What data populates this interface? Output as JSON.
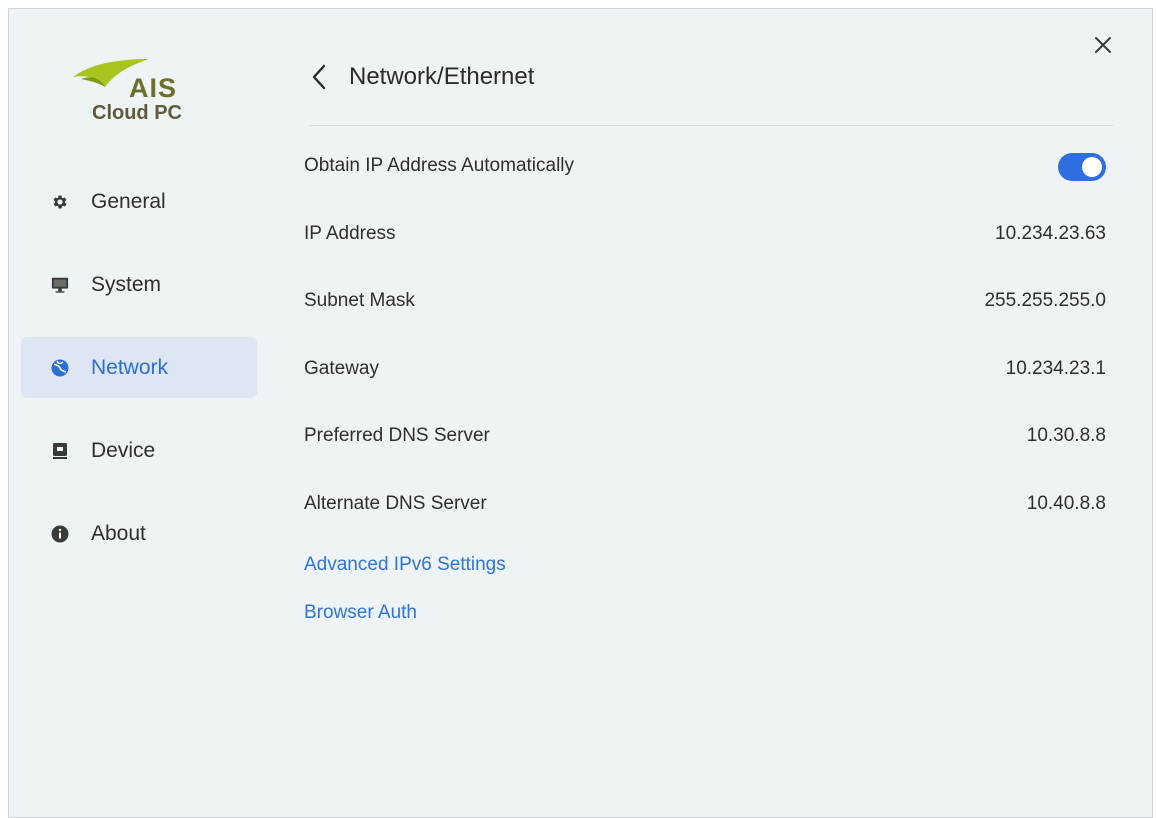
{
  "brand": {
    "name": "AIS",
    "product": "Cloud PC"
  },
  "sidebar": {
    "items": [
      {
        "label": "General",
        "icon": "gear-icon",
        "active": false
      },
      {
        "label": "System",
        "icon": "monitor-icon",
        "active": false
      },
      {
        "label": "Network",
        "icon": "globe-icon",
        "active": true
      },
      {
        "label": "Device",
        "icon": "device-icon",
        "active": false
      },
      {
        "label": "About",
        "icon": "info-icon",
        "active": false
      }
    ]
  },
  "header": {
    "title": "Network/Ethernet"
  },
  "settings": {
    "obtain_ip": {
      "label": "Obtain IP Address Automatically",
      "enabled": true
    },
    "rows": [
      {
        "label": "IP Address",
        "value": "10.234.23.63"
      },
      {
        "label": "Subnet Mask",
        "value": "255.255.255.0"
      },
      {
        "label": "Gateway",
        "value": "10.234.23.1"
      },
      {
        "label": "Preferred DNS Server",
        "value": "10.30.8.8"
      },
      {
        "label": "Alternate DNS Server",
        "value": "10.40.8.8"
      }
    ],
    "links": {
      "ipv6": "Advanced IPv6 Settings",
      "browser_auth": "Browser Auth"
    }
  },
  "colors": {
    "accent": "#2f6ee0",
    "link": "#2f74e0",
    "active_bg": "#dde6f2",
    "brand_green": "#a8c41f"
  }
}
